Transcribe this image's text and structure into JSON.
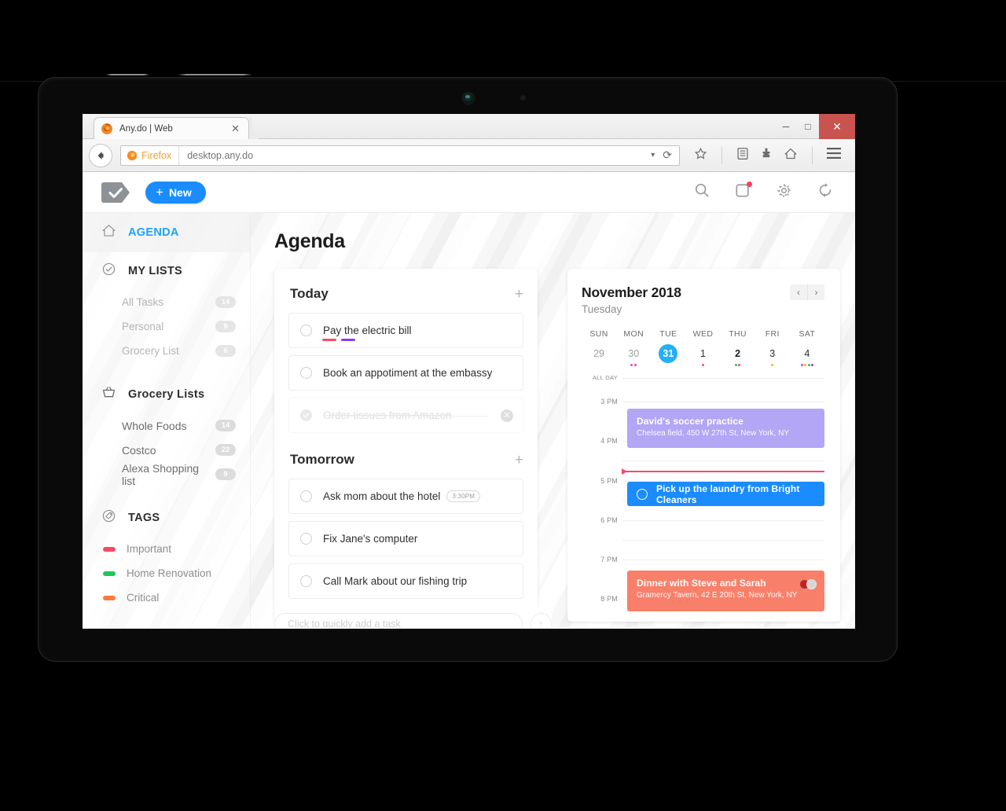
{
  "browser": {
    "tab_title": "Any.do | Web",
    "favicon": "firefox-icon",
    "close_tab": "✕",
    "url": "desktop.any.do",
    "url_brand": "Firefox",
    "window_minimize": "─",
    "window_maximize": "□",
    "window_close": "✕",
    "dropdown_arrow": "▾",
    "reload": "⟳",
    "icons": [
      "bookmark-star-icon",
      "reader-icon",
      "download-icon",
      "home-icon",
      "menu-icon"
    ]
  },
  "header": {
    "logo": "anydo-tag-check-logo",
    "new_label": "New",
    "new_plus": "+",
    "icons": [
      "search-icon",
      "notifications-icon",
      "settings-gear-icon",
      "sync-icon"
    ],
    "notification_badge_color": "#ff3b5c",
    "accent_color": "#1a8cff"
  },
  "sidebar": {
    "agenda": {
      "label": "AGENDA",
      "icon": "home-icon",
      "active_color": "#1aa3ff"
    },
    "my_lists": {
      "label": "MY LISTS",
      "icon": "check-circle-icon"
    },
    "my_lists_items": [
      {
        "label": "All Tasks",
        "count": "14"
      },
      {
        "label": "Personal",
        "count": "9"
      },
      {
        "label": "Grocery List",
        "count": "6"
      }
    ],
    "grocery_lists": {
      "label": "Grocery Lists",
      "icon": "basket-icon"
    },
    "grocery_items": [
      {
        "label": "Whole Foods",
        "count": "14"
      },
      {
        "label": "Costco",
        "count": "22"
      },
      {
        "label": "Alexa Shopping list",
        "count": "9"
      }
    ],
    "tags_head": {
      "label": "TAGS",
      "icon": "tag-circle-icon"
    },
    "tags": [
      {
        "label": "Important",
        "color": "#fa4a63"
      },
      {
        "label": "Home Renovation",
        "color": "#22c55a"
      },
      {
        "label": "Critical",
        "color": "#fa7a42"
      }
    ]
  },
  "main": {
    "page_title": "Agenda",
    "sections": [
      {
        "title": "Today",
        "add": "+",
        "tasks": [
          {
            "text": "Pay the electric bill",
            "done": false,
            "tag_colors": [
              "#fa4a63",
              "#8b3df0"
            ]
          },
          {
            "text": "Book an appotiment at the embassy",
            "done": false,
            "tag_colors": []
          },
          {
            "text": "Order tissues from Amazon",
            "done": true,
            "tag_colors": [],
            "delete": "✕"
          }
        ]
      },
      {
        "title": "Tomorrow",
        "add": "+",
        "tasks": [
          {
            "text": "Ask mom about the hotel",
            "done": false,
            "time": "3:30PM",
            "tag_colors": []
          },
          {
            "text": "Fix Jane's computer",
            "done": false,
            "tag_colors": []
          },
          {
            "text": "Call Mark about our fishing trip",
            "done": false,
            "tag_colors": []
          }
        ]
      }
    ],
    "quick_add": {
      "placeholder": "Click to quickly add a task",
      "submit": "↑"
    }
  },
  "calendar": {
    "month": "November 2018",
    "weekday": "Tuesday",
    "prev": "‹",
    "next": "›",
    "dow": [
      "SUN",
      "MON",
      "TUE",
      "WED",
      "THU",
      "FRI",
      "SAT"
    ],
    "days": [
      {
        "num": "29",
        "style": "muted",
        "dots": []
      },
      {
        "num": "30",
        "style": "muted",
        "dots": [
          "#d94bd4",
          "#fa4a63"
        ]
      },
      {
        "num": "31",
        "style": "selected",
        "dots": []
      },
      {
        "num": "1",
        "style": "dark",
        "dots": [
          "#fa4a63"
        ]
      },
      {
        "num": "2",
        "style": "bold",
        "dots": [
          "#22c55a",
          "#fa4a63"
        ]
      },
      {
        "num": "3",
        "style": "dark",
        "dots": [
          "#ffb020"
        ]
      },
      {
        "num": "4",
        "style": "dark",
        "dots": [
          "#e040c0",
          "#ffb020",
          "#22c55a",
          "#8b3df0"
        ]
      }
    ],
    "time_labels": [
      "ALL DAY",
      "3 PM",
      "4 PM",
      "5 PM",
      "6 PM",
      "7 PM",
      "8 PM"
    ],
    "now_indicator_color": "#f8476d",
    "events": [
      {
        "title": "David's soccer practice",
        "location": "Chelsea field, 450 W 27th St, New York, NY",
        "color": "#b3a6f5",
        "kind": "event"
      },
      {
        "title": "Pick up the laundry from Bright Cleaners",
        "location": "",
        "color": "#1a8cff",
        "kind": "task"
      },
      {
        "title": "Dinner with Steve and Sarah",
        "location": "Gramercy Tavern, 42 E 20th St, New York, NY",
        "color": "#f8806a",
        "kind": "event",
        "avatars": [
          "#c22222",
          "#cfcfcf"
        ]
      }
    ]
  }
}
